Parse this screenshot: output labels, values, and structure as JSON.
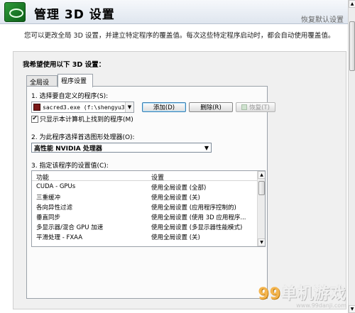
{
  "header": {
    "title": "管理 3D 设置",
    "restore_link": "恢复默认设置"
  },
  "description": "您可以更改全局 3D 设置，并建立特定程序的覆盖值。每次这些特定程序启动时，都会自动使用覆盖值。",
  "section_title": "我希望使用以下 3D 设置：",
  "tabs": [
    {
      "label": "全局设置",
      "selected": false
    },
    {
      "label": "程序设置",
      "selected": true
    }
  ],
  "program_settings": {
    "step1_label": "1. 选择要自定义的程序(S):",
    "selected_program": "sacred3.exe (f:\\shengyu3...",
    "add_button": "添加(D)",
    "delete_button": "删除(R)",
    "restore_button": "恢复(T)",
    "show_only_found_label": "只显示本计算机上找到的程序(M)",
    "show_only_found_checked": true,
    "step2_label": "2. 为此程序选择首选图形处理器(O):",
    "preferred_gpu": "高性能 NVIDIA 处理器",
    "step3_label": "3. 指定该程序的设置值(C):",
    "settings_table": {
      "columns": [
        "功能",
        "设置"
      ],
      "rows": [
        {
          "feature": "CUDA - GPUs",
          "value": "使用全局设置 (全部)"
        },
        {
          "feature": "三重缓冲",
          "value": "使用全局设置 (关)"
        },
        {
          "feature": "各向异性过滤",
          "value": "使用全局设置 (应用程序控制的)"
        },
        {
          "feature": "垂直同步",
          "value": "使用全局设置 (使用 3D 应用程序..."
        },
        {
          "feature": "多显示器/混合 GPU 加速",
          "value": "使用全局设置 (多显示器性能模式)"
        },
        {
          "feature": "平滑处理 - FXAA",
          "value": "使用全局设置 (关)"
        }
      ]
    }
  },
  "watermark": {
    "brand_prefix": "99",
    "brand_text": "单机游戏",
    "url": "www.99danji.com"
  }
}
